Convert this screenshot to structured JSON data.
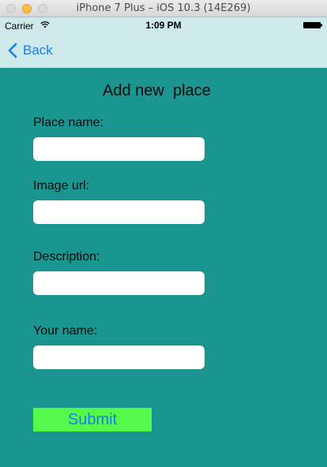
{
  "window": {
    "title": "iPhone 7 Plus – iOS 10.3 (14E269)"
  },
  "status_bar": {
    "carrier": "Carrier",
    "time": "1:09 PM",
    "wifi_icon": "wifi-icon",
    "battery_icon": "battery-icon"
  },
  "nav": {
    "back_label": "Back",
    "back_icon": "chevron-left-icon"
  },
  "form": {
    "title": "Add new  place",
    "fields": [
      {
        "label": "Place name:",
        "value": "",
        "placeholder": ""
      },
      {
        "label": "Image url:",
        "value": "",
        "placeholder": ""
      },
      {
        "label": "Description:",
        "value": "",
        "placeholder": ""
      },
      {
        "label": "Your name:",
        "value": "",
        "placeholder": ""
      }
    ],
    "submit_label": "Submit"
  },
  "colors": {
    "background": "#1a9590",
    "nav_bar": "#cde9ea",
    "submit_background": "#55f94c",
    "link_blue": "#1a7cf0"
  }
}
